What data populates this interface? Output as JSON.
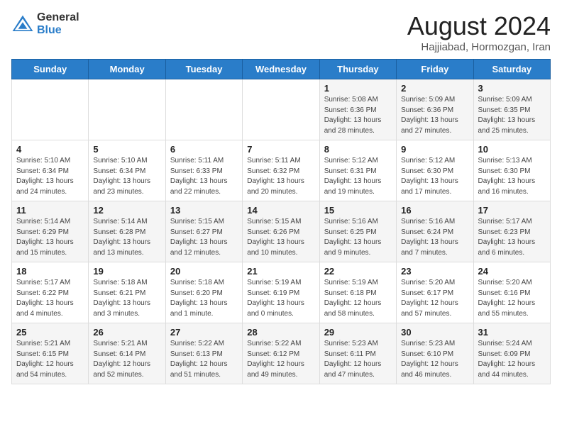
{
  "logo": {
    "general": "General",
    "blue": "Blue"
  },
  "title": "August 2024",
  "subtitle": "Hajjiabad, Hormozgan, Iran",
  "days_of_week": [
    "Sunday",
    "Monday",
    "Tuesday",
    "Wednesday",
    "Thursday",
    "Friday",
    "Saturday"
  ],
  "weeks": [
    [
      {
        "day": "",
        "info": ""
      },
      {
        "day": "",
        "info": ""
      },
      {
        "day": "",
        "info": ""
      },
      {
        "day": "",
        "info": ""
      },
      {
        "day": "1",
        "info": "Sunrise: 5:08 AM\nSunset: 6:36 PM\nDaylight: 13 hours\nand 28 minutes."
      },
      {
        "day": "2",
        "info": "Sunrise: 5:09 AM\nSunset: 6:36 PM\nDaylight: 13 hours\nand 27 minutes."
      },
      {
        "day": "3",
        "info": "Sunrise: 5:09 AM\nSunset: 6:35 PM\nDaylight: 13 hours\nand 25 minutes."
      }
    ],
    [
      {
        "day": "4",
        "info": "Sunrise: 5:10 AM\nSunset: 6:34 PM\nDaylight: 13 hours\nand 24 minutes."
      },
      {
        "day": "5",
        "info": "Sunrise: 5:10 AM\nSunset: 6:34 PM\nDaylight: 13 hours\nand 23 minutes."
      },
      {
        "day": "6",
        "info": "Sunrise: 5:11 AM\nSunset: 6:33 PM\nDaylight: 13 hours\nand 22 minutes."
      },
      {
        "day": "7",
        "info": "Sunrise: 5:11 AM\nSunset: 6:32 PM\nDaylight: 13 hours\nand 20 minutes."
      },
      {
        "day": "8",
        "info": "Sunrise: 5:12 AM\nSunset: 6:31 PM\nDaylight: 13 hours\nand 19 minutes."
      },
      {
        "day": "9",
        "info": "Sunrise: 5:12 AM\nSunset: 6:30 PM\nDaylight: 13 hours\nand 17 minutes."
      },
      {
        "day": "10",
        "info": "Sunrise: 5:13 AM\nSunset: 6:30 PM\nDaylight: 13 hours\nand 16 minutes."
      }
    ],
    [
      {
        "day": "11",
        "info": "Sunrise: 5:14 AM\nSunset: 6:29 PM\nDaylight: 13 hours\nand 15 minutes."
      },
      {
        "day": "12",
        "info": "Sunrise: 5:14 AM\nSunset: 6:28 PM\nDaylight: 13 hours\nand 13 minutes."
      },
      {
        "day": "13",
        "info": "Sunrise: 5:15 AM\nSunset: 6:27 PM\nDaylight: 13 hours\nand 12 minutes."
      },
      {
        "day": "14",
        "info": "Sunrise: 5:15 AM\nSunset: 6:26 PM\nDaylight: 13 hours\nand 10 minutes."
      },
      {
        "day": "15",
        "info": "Sunrise: 5:16 AM\nSunset: 6:25 PM\nDaylight: 13 hours\nand 9 minutes."
      },
      {
        "day": "16",
        "info": "Sunrise: 5:16 AM\nSunset: 6:24 PM\nDaylight: 13 hours\nand 7 minutes."
      },
      {
        "day": "17",
        "info": "Sunrise: 5:17 AM\nSunset: 6:23 PM\nDaylight: 13 hours\nand 6 minutes."
      }
    ],
    [
      {
        "day": "18",
        "info": "Sunrise: 5:17 AM\nSunset: 6:22 PM\nDaylight: 13 hours\nand 4 minutes."
      },
      {
        "day": "19",
        "info": "Sunrise: 5:18 AM\nSunset: 6:21 PM\nDaylight: 13 hours\nand 3 minutes."
      },
      {
        "day": "20",
        "info": "Sunrise: 5:18 AM\nSunset: 6:20 PM\nDaylight: 13 hours\nand 1 minute."
      },
      {
        "day": "21",
        "info": "Sunrise: 5:19 AM\nSunset: 6:19 PM\nDaylight: 13 hours\nand 0 minutes."
      },
      {
        "day": "22",
        "info": "Sunrise: 5:19 AM\nSunset: 6:18 PM\nDaylight: 12 hours\nand 58 minutes."
      },
      {
        "day": "23",
        "info": "Sunrise: 5:20 AM\nSunset: 6:17 PM\nDaylight: 12 hours\nand 57 minutes."
      },
      {
        "day": "24",
        "info": "Sunrise: 5:20 AM\nSunset: 6:16 PM\nDaylight: 12 hours\nand 55 minutes."
      }
    ],
    [
      {
        "day": "25",
        "info": "Sunrise: 5:21 AM\nSunset: 6:15 PM\nDaylight: 12 hours\nand 54 minutes."
      },
      {
        "day": "26",
        "info": "Sunrise: 5:21 AM\nSunset: 6:14 PM\nDaylight: 12 hours\nand 52 minutes."
      },
      {
        "day": "27",
        "info": "Sunrise: 5:22 AM\nSunset: 6:13 PM\nDaylight: 12 hours\nand 51 minutes."
      },
      {
        "day": "28",
        "info": "Sunrise: 5:22 AM\nSunset: 6:12 PM\nDaylight: 12 hours\nand 49 minutes."
      },
      {
        "day": "29",
        "info": "Sunrise: 5:23 AM\nSunset: 6:11 PM\nDaylight: 12 hours\nand 47 minutes."
      },
      {
        "day": "30",
        "info": "Sunrise: 5:23 AM\nSunset: 6:10 PM\nDaylight: 12 hours\nand 46 minutes."
      },
      {
        "day": "31",
        "info": "Sunrise: 5:24 AM\nSunset: 6:09 PM\nDaylight: 12 hours\nand 44 minutes."
      }
    ]
  ]
}
